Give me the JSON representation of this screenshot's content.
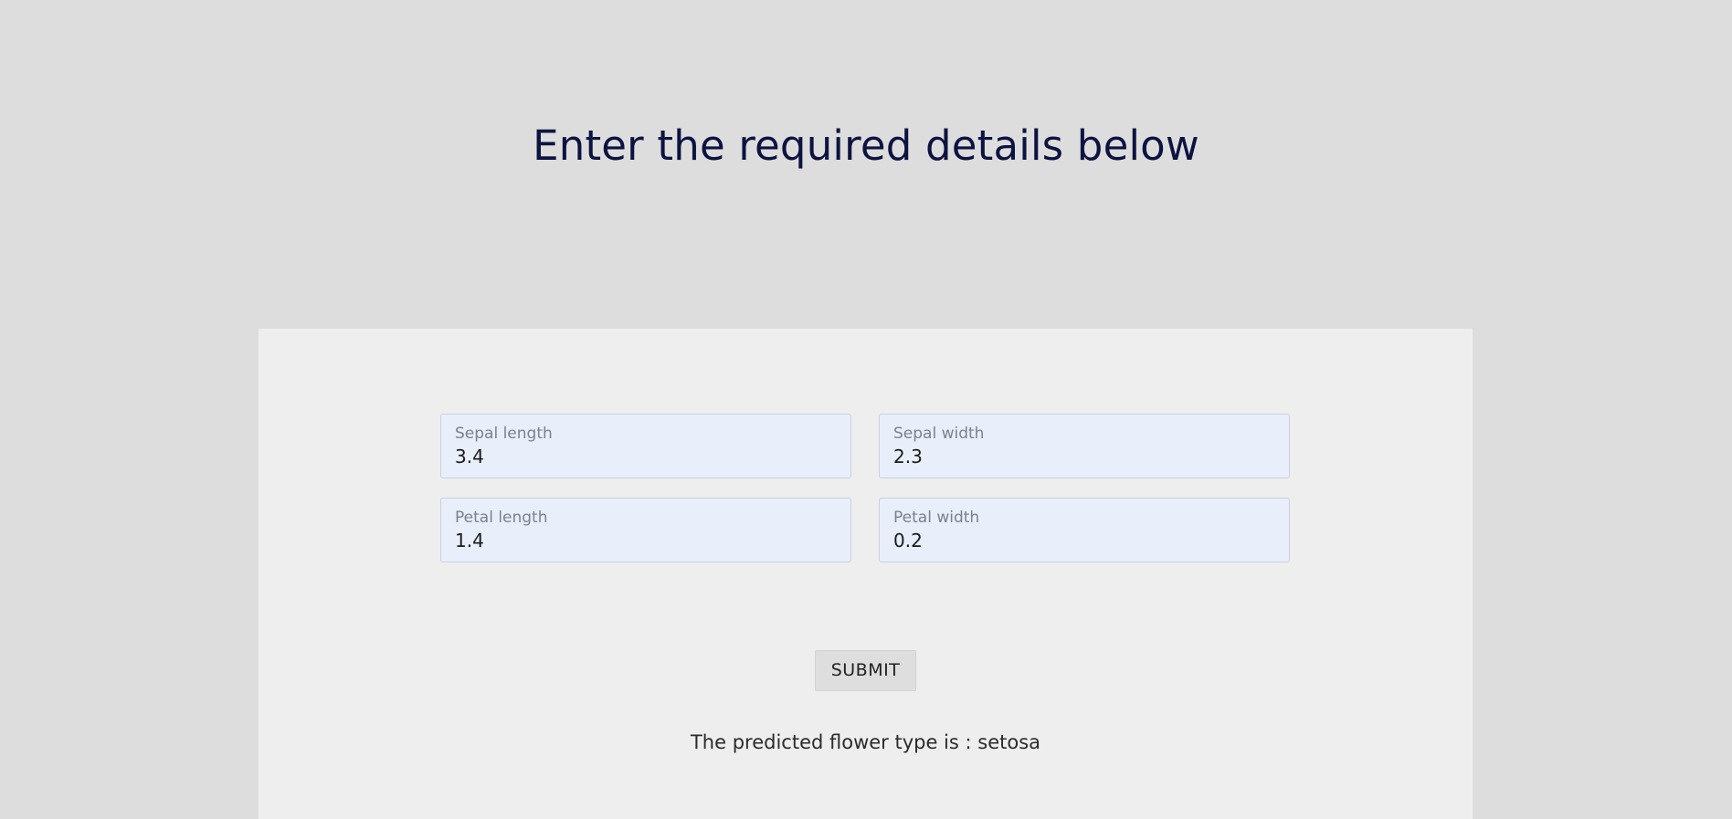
{
  "page": {
    "title": "Enter the required details below"
  },
  "form": {
    "fields": [
      {
        "label": "Sepal length",
        "value": "3.4"
      },
      {
        "label": "Sepal width",
        "value": "2.3"
      },
      {
        "label": "Petal length",
        "value": "1.4"
      },
      {
        "label": "Petal width",
        "value": "0.2"
      }
    ],
    "submit_label": "SUBMIT",
    "result": "The predicted flower type is : setosa"
  },
  "colors": {
    "page_background": "#dddddd",
    "panel_background": "#eeeeee",
    "title_color": "#0d1340",
    "field_background": "#e8effb"
  }
}
